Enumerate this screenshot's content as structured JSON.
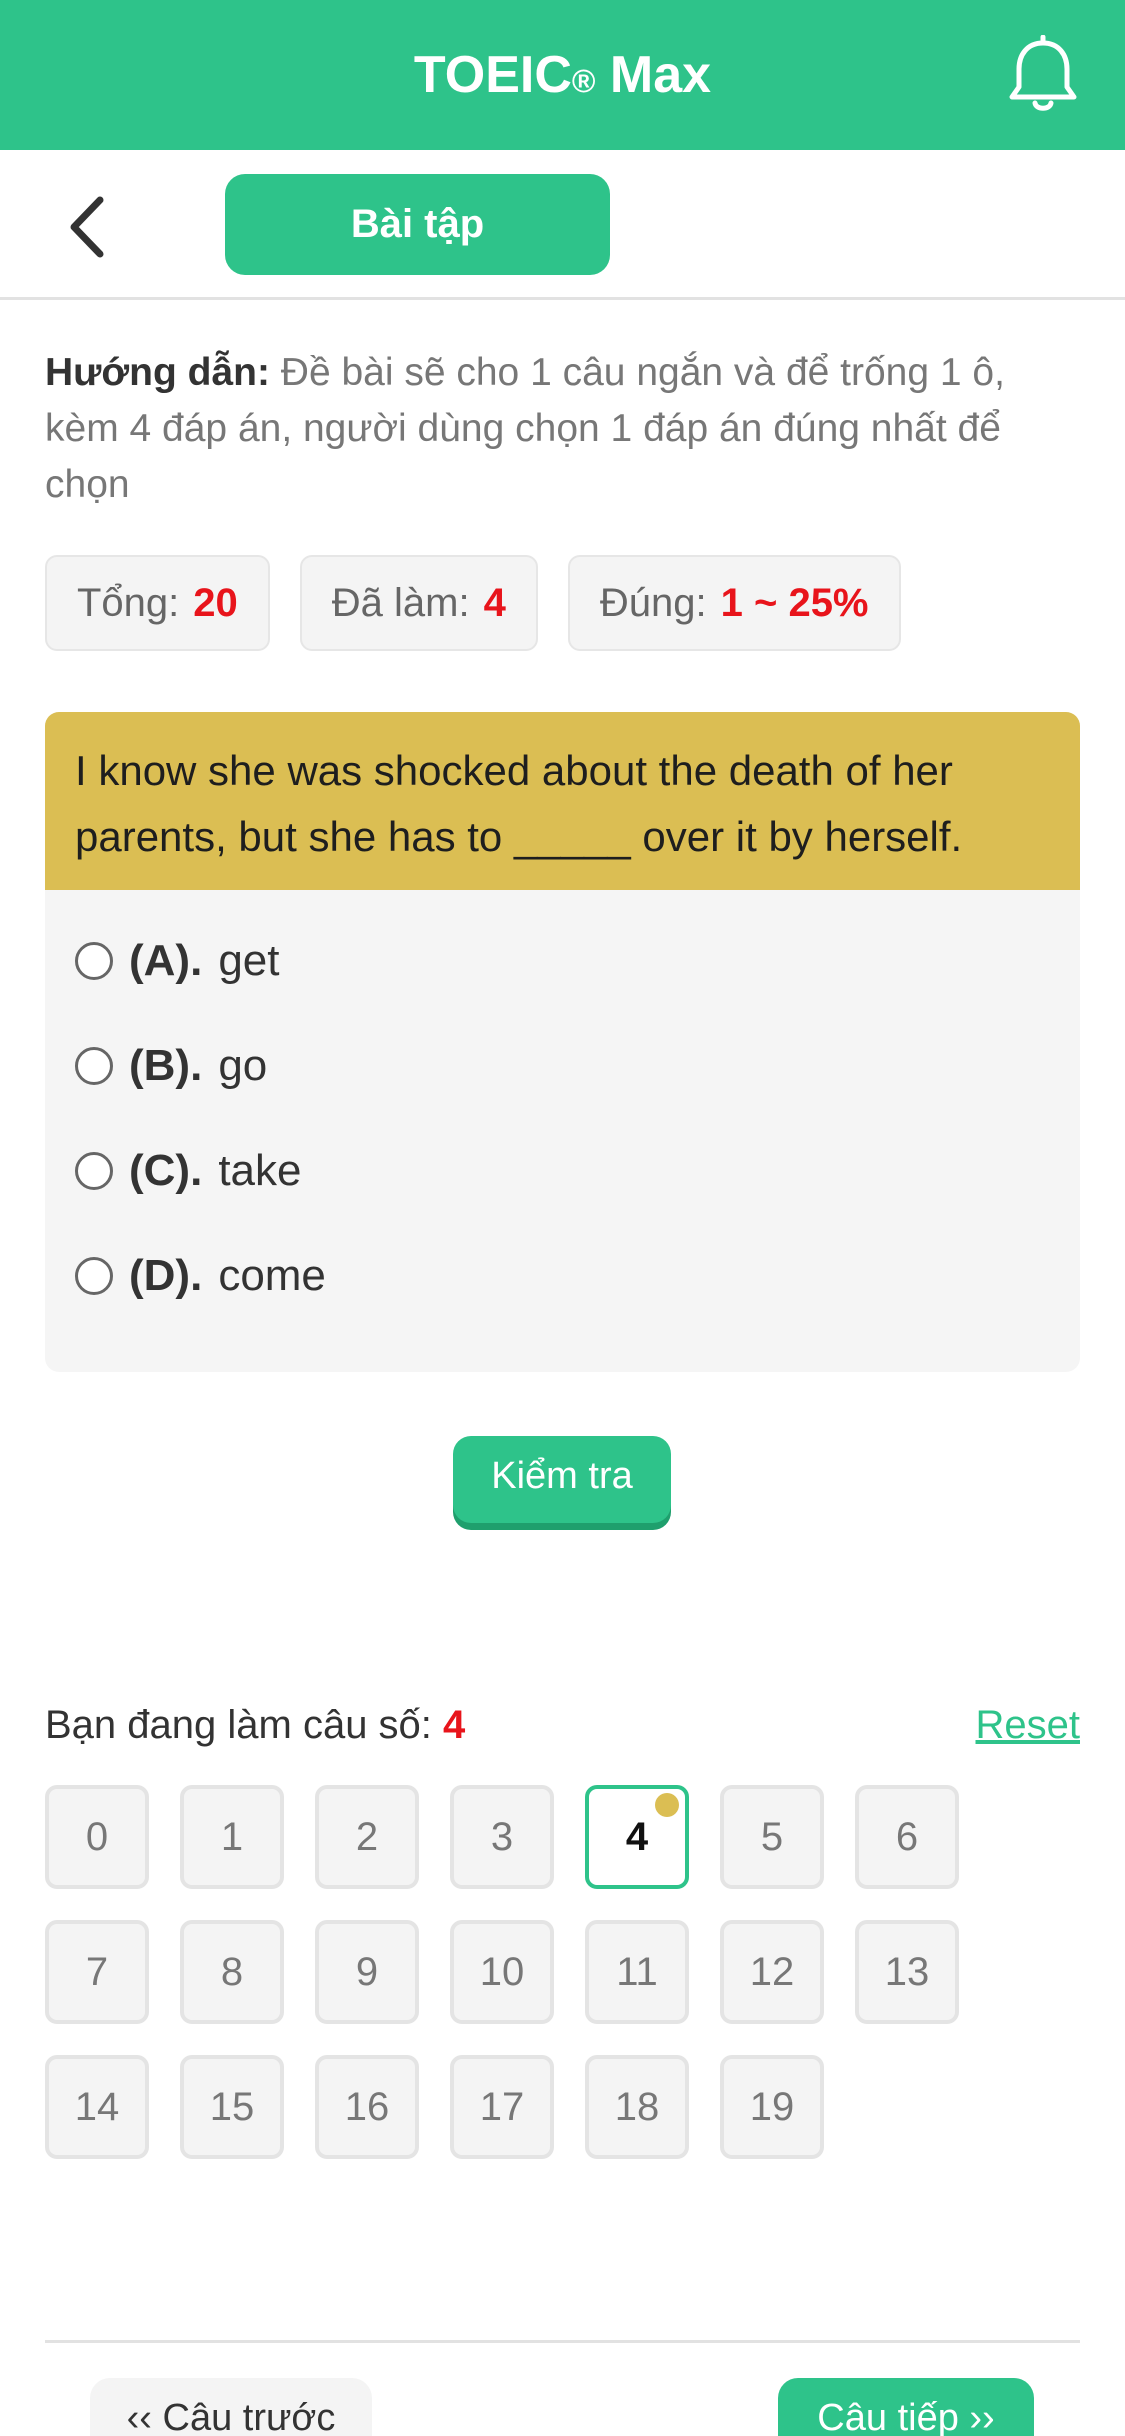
{
  "header": {
    "title": "TOEIC",
    "title_mark": "®",
    "title_suffix": " Max",
    "bell_icon": "bell-icon"
  },
  "subheader": {
    "back_icon": "chevron-left-icon",
    "tab_label": "Bài tập"
  },
  "instructions": {
    "label": "Hướng dẫn:",
    "text": " Đề bài sẽ cho 1 câu ngắn và để trống 1 ô, kèm 4 đáp án, người dùng chọn 1 đáp án đúng nhất để chọn"
  },
  "stats": {
    "total_label": "Tổng:",
    "total_value": "20",
    "done_label": "Đã làm:",
    "done_value": "4",
    "correct_label": "Đúng:",
    "correct_value": "1 ~ 25%"
  },
  "question": {
    "text": "I know she was shocked about the death of her parents, but she has to _____ over it by herself.",
    "options": [
      {
        "key": "(A).",
        "text": "get"
      },
      {
        "key": "(B).",
        "text": "go"
      },
      {
        "key": "(C).",
        "text": "take"
      },
      {
        "key": "(D).",
        "text": "come"
      }
    ]
  },
  "check_button": "Kiểm tra",
  "progress": {
    "current_label": "Bạn đang làm câu số:",
    "current_value": "4",
    "reset_label": "Reset"
  },
  "question_numbers": [
    "0",
    "1",
    "2",
    "3",
    "4",
    "5",
    "6",
    "7",
    "8",
    "9",
    "10",
    "11",
    "12",
    "13",
    "14",
    "15",
    "16",
    "17",
    "18",
    "19"
  ],
  "active_question": 4,
  "nav": {
    "prev_label": "‹‹ Câu trước",
    "next_label": "Câu tiếp ››"
  },
  "colors": {
    "brand": "#2ec38a",
    "question_bg": "#dbbe53",
    "highlight": "#e8141b"
  }
}
